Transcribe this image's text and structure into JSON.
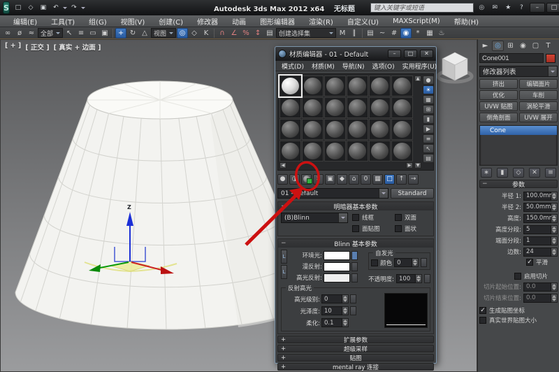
{
  "window": {
    "title": "Autodesk 3ds Max  2012 x64",
    "doc_title": "无标题",
    "search_placeholder": "键入关键字或短语"
  },
  "menus": [
    "编辑(E)",
    "工具(T)",
    "组(G)",
    "视图(V)",
    "创建(C)",
    "修改器",
    "动画",
    "图形编辑器",
    "渲染(R)",
    "自定义(U)",
    "MAXScript(M)",
    "帮助(H)"
  ],
  "toolbar": {
    "selection_filter": "全部",
    "ref_coord": "视图",
    "named_selection": "创建选择集"
  },
  "viewport": {
    "label_plus": "[ + ]",
    "label_pov": "[ 正交 ]",
    "label_shading": "[ 真实 + 边面 ]"
  },
  "materialEditor": {
    "title": "材质编辑器 - 01 - Default",
    "menus": [
      "模式(D)",
      "材质(M)",
      "导航(N)",
      "选项(O)",
      "实用程序(U)"
    ],
    "material_name": "01 - Default",
    "material_type": "Standard",
    "shader_rollout": {
      "title": "明暗器基本参数",
      "shader": "(B)Blinn",
      "cb_wire": "线框",
      "cb_2sided": "双面",
      "cb_facemap": "面贴图",
      "cb_faceted": "面状"
    },
    "blinn_rollout": {
      "title": "Blinn 基本参数",
      "ambient": "环境光:",
      "diffuse": "漫反射:",
      "specular": "高光反射:",
      "selfillum_title": "自发光",
      "selfillum_color": "颜色",
      "selfillum_value": "0",
      "opacity_label": "不透明度:",
      "opacity_value": "100",
      "hl_title": "反射高光",
      "spec_level_label": "高光级别:",
      "spec_level_value": "0",
      "gloss_label": "光泽度:",
      "gloss_value": "10",
      "soften_label": "柔化:",
      "soften_value": "0.1"
    },
    "rollouts": [
      "扩展参数",
      "超级采样",
      "贴图",
      "mental ray 连接"
    ]
  },
  "commandPanel": {
    "object_name": "Cone001",
    "modifier_list_label": "修改器列表",
    "modifier_buttons": [
      [
        "挤出",
        "编辑面片"
      ],
      [
        "优化",
        "车削"
      ],
      [
        "UVW 贴图",
        "涡轮平滑"
      ],
      [
        "倒角剖面",
        "UVW 展开"
      ]
    ],
    "stack_item": "Cone",
    "params": {
      "title": "参数",
      "rows": [
        {
          "label": "半径 1:",
          "value": "100.0mm"
        },
        {
          "label": "半径 2:",
          "value": "50.0mm"
        },
        {
          "label": "高度:",
          "value": "150.0mm"
        },
        {
          "label": "高度分段:",
          "value": "5"
        },
        {
          "label": "端面分段:",
          "value": "1"
        },
        {
          "label": "边数:",
          "value": "24"
        }
      ],
      "smooth": "平滑",
      "enable_slice": "启用切片",
      "slice_from_label": "切片起始位置:",
      "slice_from_value": "0.0",
      "slice_to_label": "切片结束位置:",
      "slice_to_value": "0.0",
      "gen_mapping": "生成贴图坐标",
      "real_world": "真实世界贴图大小"
    }
  },
  "colors": {
    "accent_blue": "#3e78c2",
    "annotation_red": "#cc1111",
    "object_color_swatch": "#c23b2e",
    "selection_highlight": "#2f62a8"
  },
  "checks": {
    "checked": "✓",
    "unchecked": ""
  },
  "icons": {
    "logo": "S",
    "new": "□",
    "open": "◇",
    "save": "▣",
    "undo": "↶",
    "redo": "↷",
    "ic_search": "◎",
    "ic_comm": "✉",
    "ic_fav": "★",
    "ic_help": "?",
    "win_min": "–",
    "win_max": "□",
    "win_close": "✕",
    "link": "∞",
    "unlink": "ø",
    "bind": "≈",
    "select": "↖",
    "byname": "≡",
    "region": "▭",
    "crossing": "▣",
    "move": "+",
    "rotate": "↻",
    "scale": "△",
    "pivot": "◎",
    "manip": "◇",
    "kbd": "K",
    "snap": "∩",
    "asnap": "∠",
    "psnap": "%",
    "ssnap": "↕",
    "sets": "▤",
    "mirror": "M",
    "align": "∥",
    "layers": "▤",
    "curve": "~",
    "schem": "#",
    "mtl": "◉",
    "rsetup": "*",
    "rframe": "▦",
    "render": "♨",
    "me_get": "●",
    "me_put": "◑",
    "me_reset": "✕",
    "me_copy": "▣",
    "me_unique": "◆",
    "me_lib": "⌂",
    "me_id": "0",
    "me_showmap": "▦",
    "me_showend": "□",
    "me_parent": "↑",
    "me_sibling": "→",
    "vt_type": "●",
    "vt_backlight": "☀",
    "vt_bg": "▦",
    "vt_tile": "⊞",
    "vt_video": "▮",
    "vt_preview": "▶",
    "vt_opts": "≡",
    "vt_selmtl": "↖",
    "vt_nav": "▤",
    "cp_create": "►",
    "cp_modify": "◎",
    "cp_hier": "⊞",
    "cp_motion": "◉",
    "cp_display": "▢",
    "cp_util": "T",
    "sk_pin": "∗",
    "sk_showend": "▮",
    "sk_unique": "◇",
    "sk_remove": "✕",
    "sk_config": "≡",
    "lock": "L"
  }
}
